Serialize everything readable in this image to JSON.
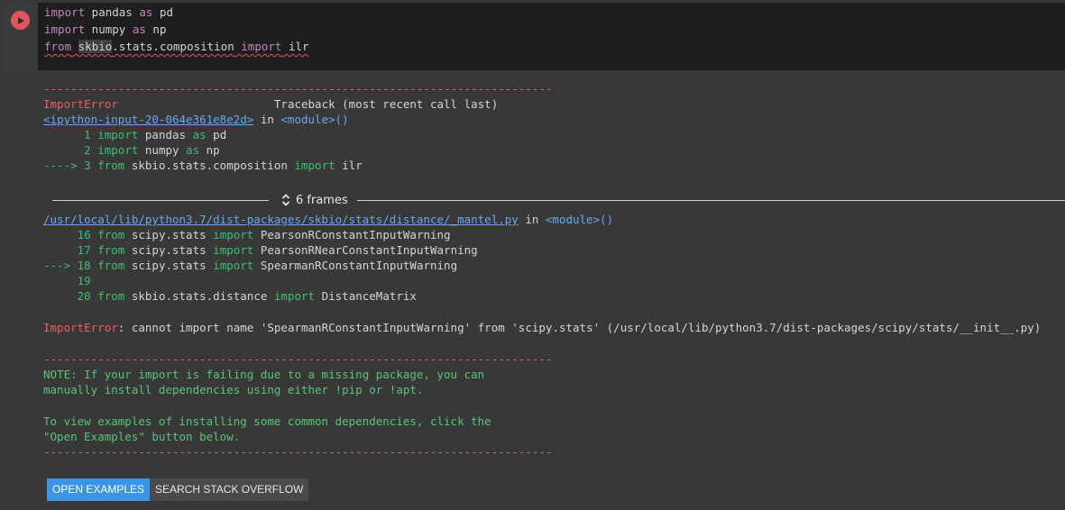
{
  "code": {
    "lines": [
      {
        "kw1": "import",
        "mid": " pandas ",
        "kw2": "as",
        "tail": " pd"
      },
      {
        "kw1": "import",
        "mid": " numpy ",
        "kw2": "as",
        "tail": " np"
      },
      {
        "kw1": "from",
        "sp1": " ",
        "mod_hl": "skbio",
        "mod_rest": ".stats.composition",
        "sp2": " ",
        "kw2": "import",
        "tail": " ilr"
      }
    ]
  },
  "output": {
    "sep": "---------------------------------------------------------------------------",
    "error_name": "ImportError",
    "traceback_header": "                       Traceback (most recent call last)",
    "frame1": {
      "link": "<ipython-input-20-064e361e8e2d>",
      "in": " in ",
      "module": "<module>()",
      "lines": [
        {
          "num": "      1 ",
          "kw": "import",
          "rest": " pandas ",
          "kw2": "as",
          "tail": " pd"
        },
        {
          "num": "      2 ",
          "kw": "import",
          "rest": " numpy ",
          "kw2": "as",
          "tail": " np"
        },
        {
          "num": "----> 3 ",
          "kw": "from",
          "rest": " skbio.stats.composition ",
          "kw2": "import",
          "tail": " ilr"
        }
      ]
    },
    "frames_label": "6 frames",
    "frame2": {
      "link": "/usr/local/lib/python3.7/dist-packages/skbio/stats/distance/_mantel.py",
      "in": " in ",
      "module": "<module>()",
      "lines": [
        {
          "num": "     16 ",
          "kw": "from",
          "rest": " scipy.stats ",
          "kw2": "import",
          "tail": " PearsonRConstantInputWarning"
        },
        {
          "num": "     17 ",
          "kw": "from",
          "rest": " scipy.stats ",
          "kw2": "import",
          "tail": " PearsonRNearConstantInputWarning"
        },
        {
          "num": "---> 18 ",
          "kw": "from",
          "rest": " scipy.stats ",
          "kw2": "import",
          "tail": " SpearmanRConstantInputWarning"
        },
        {
          "num": "     19",
          "kw": "",
          "rest": "",
          "kw2": "",
          "tail": ""
        },
        {
          "num": "     20 ",
          "kw": "from",
          "rest": " skbio.stats.distance ",
          "kw2": "import",
          "tail": " DistanceMatrix"
        }
      ]
    },
    "error_message": ": cannot import name 'SpearmanRConstantInputWarning' from 'scipy.stats' (/usr/local/lib/python3.7/dist-packages/scipy/stats/__init__.py)",
    "note": [
      "NOTE: If your import is failing due to a missing package, you can",
      "manually install dependencies using either !pip or !apt.",
      "",
      "To view examples of installing some common dependencies, click the",
      "\"Open Examples\" button below."
    ]
  },
  "buttons": {
    "open_examples": "OPEN EXAMPLES",
    "search_stack_overflow": "SEARCH STACK OVERFLOW"
  },
  "colors": {
    "error": "#f55c5c",
    "green": "#3fbf72",
    "link": "#69a8f0",
    "keyword": "#c586c0",
    "primary_button": "#3b95e4"
  }
}
